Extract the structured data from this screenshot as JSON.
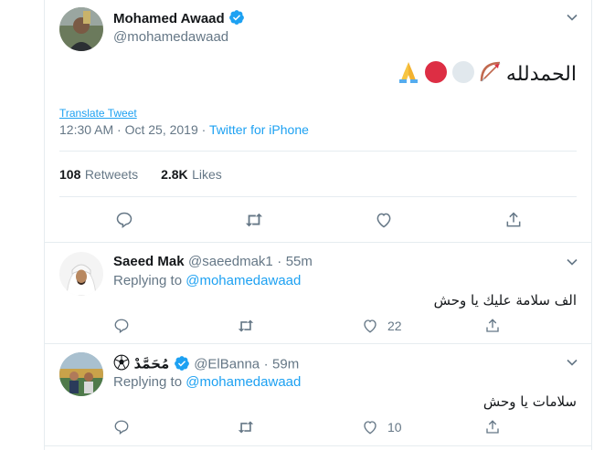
{
  "main_tweet": {
    "author_name": "Mohamed Awaad",
    "handle": "@mohamedawaad",
    "text": "الحمدلله",
    "emojis": [
      "bow-and-arrow-emoji",
      "white-circle-emoji",
      "red-circle-emoji",
      "folded-hands-emoji"
    ],
    "translate_label": "Translate Tweet",
    "time": "12:30 AM · Oct 25, 2019 · ",
    "source": "Twitter for iPhone",
    "retweets_count": "108",
    "retweets_label": "Retweets",
    "likes_count": "2.8K",
    "likes_label": "Likes"
  },
  "replies": [
    {
      "author_name": "Saeed Mak",
      "handle": "@saeedmak1",
      "time": "55m",
      "replying_label": "Replying to",
      "replying_to": "@mohamedawaad",
      "text": "الف سلامة عليك يا وحش",
      "likes": "22"
    },
    {
      "author_name": "مُحَمَّدْ",
      "handle": "@ElBanna",
      "time": "59m",
      "replying_label": "Replying to",
      "replying_to": "@mohamedawaad",
      "text": "سلامات يا وحش",
      "likes": "10"
    }
  ],
  "colors": {
    "accent": "#1da1f2",
    "secondary_text": "#657786",
    "divider": "#e6ecf0"
  }
}
